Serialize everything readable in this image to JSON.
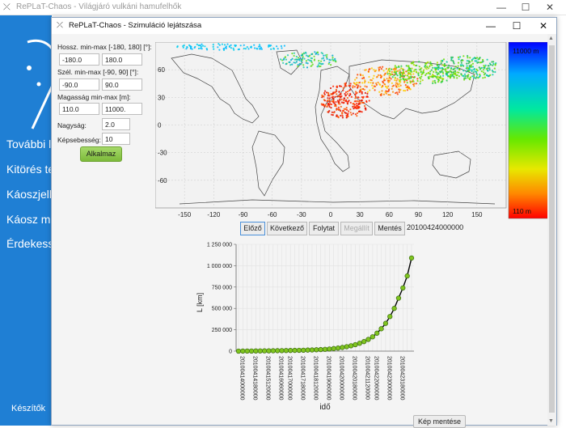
{
  "main_window": {
    "title": "RePLaT-Chaos - Világjáró vulkáni hamufelhők",
    "icon": "replat-app-icon",
    "controls": {
      "minimize": "—",
      "maximize": "☐",
      "close": "✕"
    }
  },
  "sidebar": {
    "items": [
      {
        "label": "További l"
      },
      {
        "label": "Kitörés te"
      },
      {
        "label": "Káoszjelle"
      },
      {
        "label": "Káosz me"
      },
      {
        "label": "Érdekess"
      }
    ],
    "authors_label": "Készítők"
  },
  "dialog": {
    "title": "RePLaT-Chaos - Szimuláció lejátszása",
    "controls": {
      "minimize": "—",
      "maximize": "☐",
      "close": "✕"
    }
  },
  "params": {
    "lon_label": "Hossz. min-max [-180, 180] [°]:",
    "lon_min": "-180.0",
    "lon_max": "180.0",
    "lat_label": "Szél. min-max [-90, 90] [°]:",
    "lat_min": "-90.0",
    "lat_max": "90.0",
    "alt_label": "Magasság min-max [m]:",
    "alt_min": "110.0",
    "alt_max": "11000.",
    "size_label": "Nagyság:",
    "size_value": "2.0",
    "fps_label": "Képsebesség:",
    "fps_value": "10",
    "apply_label": "Alkalmaz"
  },
  "map": {
    "x_ticks": [
      "-150",
      "-120",
      "-90",
      "-60",
      "-30",
      "0",
      "30",
      "60",
      "90",
      "120",
      "150"
    ],
    "y_ticks": [
      "60",
      "30",
      "0",
      "-30",
      "-60"
    ],
    "colorbar_max_label": "11000 m",
    "colorbar_min_label": "110 m"
  },
  "navigation": {
    "prev": "Előző",
    "next": "Következő",
    "continue": "Folytat",
    "stop": "Megállít",
    "save": "Mentés",
    "timestamp": "20100424000000"
  },
  "chart_data": {
    "type": "line",
    "xlabel": "idő",
    "ylabel": "L [km]",
    "ylim": [
      0,
      1250000
    ],
    "y_ticks": [
      "1 250 000",
      "1 000 000",
      "750 000",
      "500 000",
      "250 000",
      "0"
    ],
    "x_tick_labels": [
      "20100414000000",
      "20100414180000",
      "20100415120000",
      "20100416060000",
      "20100417000000",
      "20100417180000",
      "20100418120000",
      "20100419060000",
      "20100420000000",
      "20100420180000",
      "20100421120000",
      "20100422060000",
      "20100423000000",
      "20100423180000"
    ],
    "series": [
      {
        "values": [
          0,
          500,
          1000,
          1500,
          2000,
          2600,
          3200,
          3800,
          4500,
          5200,
          6000,
          6800,
          7700,
          8700,
          9800,
          11000,
          12500,
          14000,
          16000,
          18500,
          21500,
          25000,
          30000,
          36000,
          43000,
          52000,
          63000,
          76000,
          92000,
          112000,
          137000,
          168000,
          210000,
          262000,
          325000,
          405000,
          500000,
          620000,
          740000,
          880000,
          1090000
        ]
      }
    ],
    "line_color": "#000000",
    "marker_color": "#7fc41f"
  },
  "footer": {
    "save_image_label": "Kép mentése"
  }
}
